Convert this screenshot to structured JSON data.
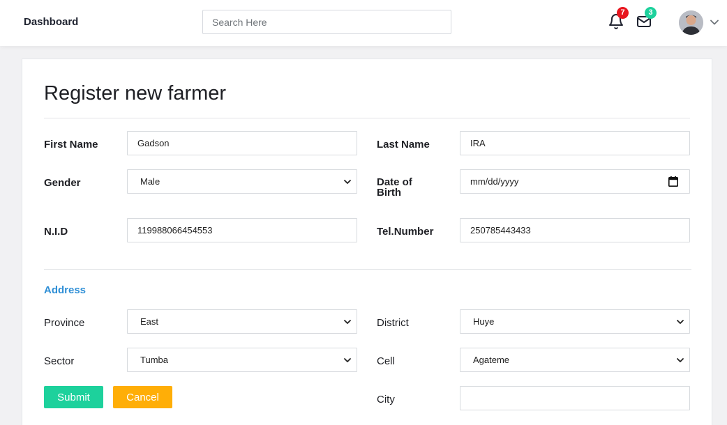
{
  "header": {
    "brand": "Dashboard",
    "search_placeholder": "Search Here",
    "notifications_count": "7",
    "messages_count": "3",
    "colors": {
      "notif_badge": "#e8161f",
      "msg_badge": "#1dd19c"
    }
  },
  "form": {
    "title": "Register new farmer",
    "first_name_label": "First Name",
    "first_name_value": "Gadson",
    "last_name_label": "Last Name",
    "last_name_value": "IRA",
    "gender_label": "Gender",
    "gender_value": "Male",
    "dob_label_line1": "Date of",
    "dob_label_line2": "Birth",
    "dob_placeholder": "mm/dd/yyyy",
    "nid_label": "N.I.D",
    "nid_value": "119988066454553",
    "tel_label": "Tel.Number",
    "tel_value": "250785443433",
    "address_heading": "Address",
    "province_label": "Province",
    "province_value": "East",
    "district_label": "District",
    "district_value": "Huye",
    "sector_label": "Sector",
    "sector_value": "Tumba",
    "cell_label": "Cell",
    "cell_value": "Agateme",
    "city_label": "City",
    "city_value": "",
    "submit_label": "Submit",
    "cancel_label": "Cancel",
    "colors": {
      "accent": "#2f8fd6",
      "submit": "#1dd19c",
      "cancel": "#ffae07"
    }
  }
}
